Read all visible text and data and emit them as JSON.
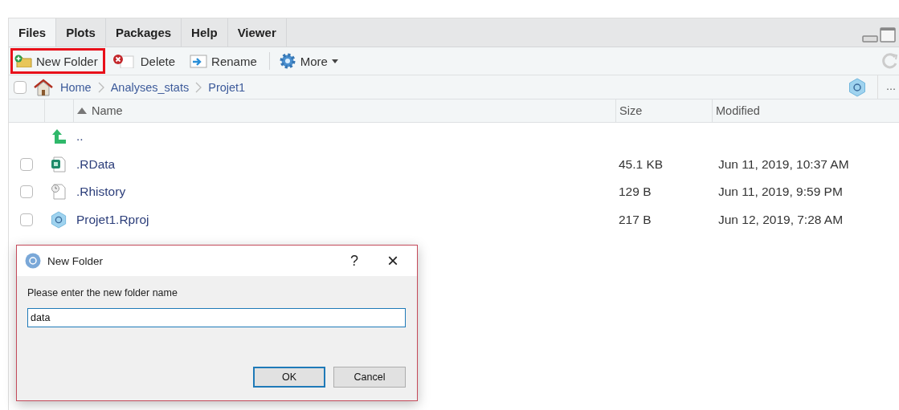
{
  "tabs": [
    {
      "label": "Files",
      "selected": true
    },
    {
      "label": "Plots",
      "selected": false
    },
    {
      "label": "Packages",
      "selected": false
    },
    {
      "label": "Help",
      "selected": false
    },
    {
      "label": "Viewer",
      "selected": false
    }
  ],
  "toolbar": [
    {
      "kind": "new-folder",
      "label": "New Folder",
      "highlighted": true
    },
    {
      "kind": "delete",
      "label": "Delete",
      "highlighted": false
    },
    {
      "kind": "rename",
      "label": "Rename",
      "highlighted": false
    },
    {
      "kind": "more",
      "label": "More",
      "highlighted": false
    }
  ],
  "select_all": {
    "checked": false
  },
  "breadcrumb": [
    "Home",
    "Analyses_stats",
    "Projet1"
  ],
  "breadcrumb_more": "...",
  "columns": {
    "name": "Name",
    "size": "Size",
    "modified": "Modified"
  },
  "rows": [
    {
      "kind": "up",
      "name": ".."
    },
    {
      "kind": "rdata",
      "name": ".RData",
      "size": "45.1 KB",
      "modified": "Jun 11, 2019, 10:37 AM",
      "checked": false
    },
    {
      "kind": "history",
      "name": ".Rhistory",
      "size": "129 B",
      "modified": "Jun 11, 2019, 9:59 PM",
      "checked": false
    },
    {
      "kind": "rproj",
      "name": "Projet1.Rproj",
      "size": "217 B",
      "modified": "Jun 12, 2019, 7:28 AM",
      "checked": false
    }
  ],
  "dialog": {
    "title": "New Folder",
    "help": "?",
    "close": "×",
    "prompt": "Please enter the new folder name",
    "value": "data",
    "buttons": [
      {
        "label": "OK",
        "default": true
      },
      {
        "label": "Cancel",
        "default": false
      }
    ]
  }
}
